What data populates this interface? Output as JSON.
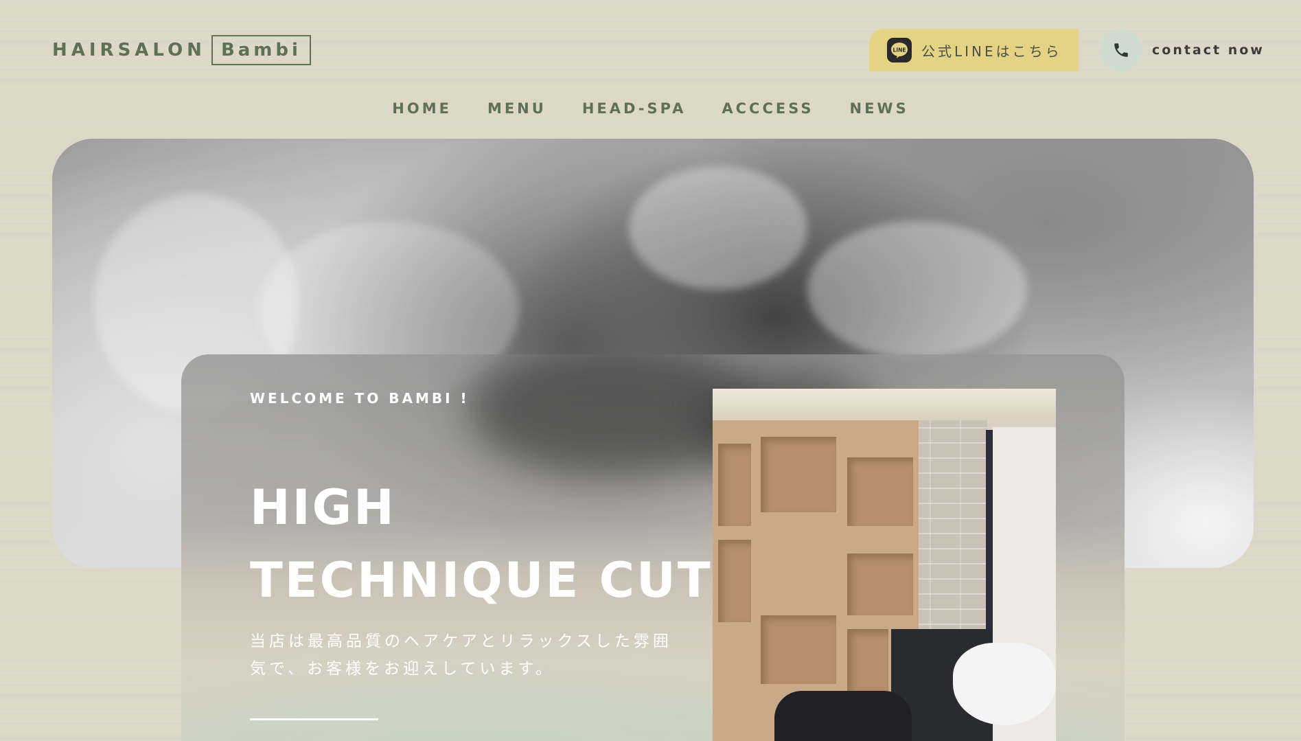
{
  "header": {
    "logo_text": "HAIRSALON",
    "logo_box_text": "Bambi",
    "line_button_label": "公式LINEはこちら",
    "line_icon_text": "LINE",
    "contact_label": "contact now"
  },
  "nav": {
    "items": [
      "HOME",
      "MENU",
      "HEAD-SPA",
      "ACCCESS",
      "NEWS"
    ]
  },
  "hero": {
    "welcome": "WELCOME TO BAMBI !",
    "headline_line1": "HIGH",
    "headline_line2": "TECHNIQUE CUT",
    "description": "当店は最高品質のヘアケアとリラックスした雰囲気で、お客様をお迎えしています。"
  },
  "icons": {
    "line": "line-app-icon",
    "phone": "phone-icon"
  },
  "colors": {
    "background": "#ddd7c7",
    "brand_green": "#5d7058",
    "line_button": "#e5d384",
    "phone_circle": "#cfdbd0"
  }
}
